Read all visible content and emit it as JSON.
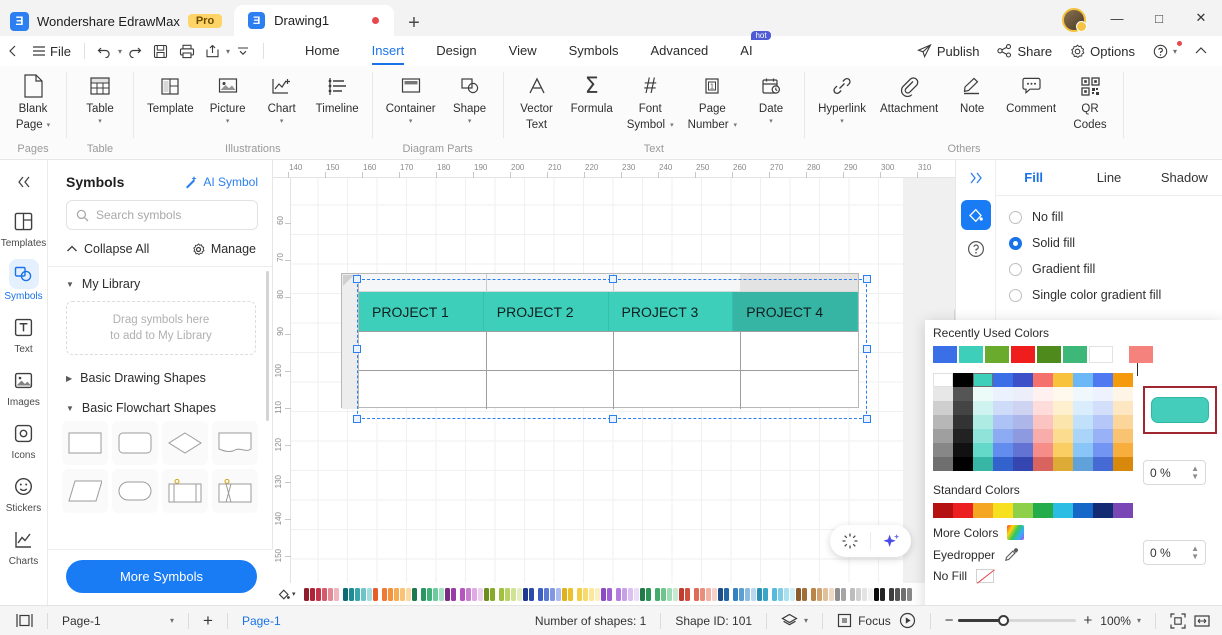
{
  "titlebar": {
    "brand": "Wondershare EdrawMax",
    "pro_badge": "Pro",
    "document_tab": "Drawing1",
    "new_tab_label": "+",
    "minimize": "—",
    "maximize": "□",
    "close": "✕"
  },
  "menubar": {
    "file_label": "File",
    "tabs": [
      {
        "label": "Home",
        "active": false
      },
      {
        "label": "Insert",
        "active": true
      },
      {
        "label": "Design",
        "active": false
      },
      {
        "label": "View",
        "active": false
      },
      {
        "label": "Symbols",
        "active": false
      },
      {
        "label": "Advanced",
        "active": false
      },
      {
        "label": "AI",
        "active": false,
        "badge": "hot"
      }
    ],
    "right": [
      {
        "label": "Publish"
      },
      {
        "label": "Share"
      },
      {
        "label": "Options"
      }
    ]
  },
  "ribbon": {
    "groups": [
      {
        "name": "Pages",
        "items": [
          {
            "label": "Blank\nPage",
            "label1": "Blank",
            "label2": "Page",
            "caret": true
          }
        ]
      },
      {
        "name": "Table",
        "items": [
          {
            "label1": "Table",
            "label2": "",
            "caret": true
          }
        ]
      },
      {
        "name": "Illustrations",
        "items": [
          {
            "label1": "Template",
            "label2": "",
            "caret": false
          },
          {
            "label1": "Picture",
            "label2": "",
            "caret": true
          },
          {
            "label1": "Chart",
            "label2": "",
            "caret": true
          },
          {
            "label1": "Timeline",
            "label2": "",
            "caret": false
          }
        ]
      },
      {
        "name": "Diagram Parts",
        "items": [
          {
            "label1": "Container",
            "label2": "",
            "caret": true
          },
          {
            "label1": "Shape",
            "label2": "",
            "caret": true
          }
        ]
      },
      {
        "name": "Text",
        "items": [
          {
            "label1": "Vector",
            "label2": "Text",
            "caret": false
          },
          {
            "label1": "Formula",
            "label2": "",
            "caret": false
          },
          {
            "label1": "Font",
            "label2": "Symbol",
            "caret": true
          },
          {
            "label1": "Page",
            "label2": "Number",
            "caret": true
          },
          {
            "label1": "Date",
            "label2": "",
            "caret": true
          }
        ]
      },
      {
        "name": "Others",
        "items": [
          {
            "label1": "Hyperlink",
            "label2": "",
            "caret": true
          },
          {
            "label1": "Attachment",
            "label2": "",
            "caret": false
          },
          {
            "label1": "Note",
            "label2": "",
            "caret": false
          },
          {
            "label1": "Comment",
            "label2": "",
            "caret": false
          },
          {
            "label1": "QR",
            "label2": "Codes",
            "caret": false
          }
        ]
      }
    ]
  },
  "rail": {
    "items": [
      {
        "label": "Templates",
        "icon": "templates-icon",
        "active": false
      },
      {
        "label": "Symbols",
        "icon": "symbols-icon",
        "active": true
      },
      {
        "label": "Text",
        "icon": "text-icon",
        "active": false
      },
      {
        "label": "Images",
        "icon": "images-icon",
        "active": false
      },
      {
        "label": "Icons",
        "icon": "icons-icon",
        "active": false
      },
      {
        "label": "Stickers",
        "icon": "stickers-icon",
        "active": false
      },
      {
        "label": "Charts",
        "icon": "charts-icon",
        "active": false
      }
    ]
  },
  "symbols_panel": {
    "title": "Symbols",
    "ai_symbol": "AI Symbol",
    "search_placeholder": "Search symbols",
    "collapse_all": "Collapse All",
    "manage": "Manage",
    "sections": [
      {
        "label": "My Library",
        "expanded": true
      },
      {
        "label": "Basic Drawing Shapes",
        "expanded": false
      },
      {
        "label": "Basic Flowchart Shapes",
        "expanded": true
      }
    ],
    "drop_hint_line1": "Drag symbols here",
    "drop_hint_line2": "to add to My Library",
    "more_symbols": "More Symbols"
  },
  "canvas": {
    "h_ruler_ticks": [
      "140",
      "150",
      "160",
      "170",
      "180",
      "190",
      "200",
      "210",
      "220",
      "230",
      "240",
      "250",
      "260",
      "270",
      "280",
      "290",
      "300",
      "310"
    ],
    "v_ruler_ticks": [
      "60",
      "70",
      "80",
      "90",
      "100",
      "110",
      "120",
      "130",
      "140",
      "150"
    ],
    "table_cells": [
      "PROJECT 1",
      "PROJECT 2",
      "PROJECT 3",
      "PROJECT 4"
    ],
    "shape_fill": "#3ecfbb",
    "shape_fill_selected": "#36b5a4",
    "selection_color": "#2b7ff0"
  },
  "right_panel": {
    "tabs": [
      {
        "label": "Fill",
        "active": true
      },
      {
        "label": "Line",
        "active": false
      },
      {
        "label": "Shadow",
        "active": false
      }
    ],
    "fill_options": [
      {
        "label": "No fill",
        "selected": false
      },
      {
        "label": "Solid fill",
        "selected": true
      },
      {
        "label": "Gradient fill",
        "selected": false
      },
      {
        "label": "Single color gradient fill",
        "selected": false
      }
    ]
  },
  "color_popover": {
    "recently_used_label": "Recently Used Colors",
    "recently_used": [
      "#3b6fe8",
      "#3ecfbb",
      "#6aab2e",
      "#f01d1d",
      "#4f8a1c",
      "#3eb878",
      "#ffffff",
      "#f5827c"
    ],
    "standard_colors_label": "Standard Colors",
    "standard_colors": [
      "#b51111",
      "#ec2020",
      "#f5a623",
      "#f7e01f",
      "#8fd04a",
      "#25ac4b",
      "#2bbde4",
      "#1668c8",
      "#132b73",
      "#7a45b5"
    ],
    "palette_top_row": [
      "#ffffff",
      "#000000",
      "#3ecfbb",
      "#3b6fe8",
      "#3c50c8",
      "#f5716c",
      "#f9c23c",
      "#6cb7f5",
      "#4f79f0",
      "#f59a0b"
    ],
    "selected_palette_index": 2,
    "more_colors": "More Colors",
    "eyedropper": "Eyedropper",
    "no_fill": "No Fill",
    "transparency_value_top": "0 %",
    "transparency_value_bottom": "0 %",
    "preview_color": "#45cdbb"
  },
  "status": {
    "page_select": "Page-1",
    "add_page": "+",
    "page_tab": "Page-1",
    "shape_count": "Number of shapes: 1",
    "shape_id": "Shape ID: 101",
    "focus": "Focus",
    "zoom_minus": "−",
    "zoom_plus": "+",
    "zoom_level": "100%"
  }
}
